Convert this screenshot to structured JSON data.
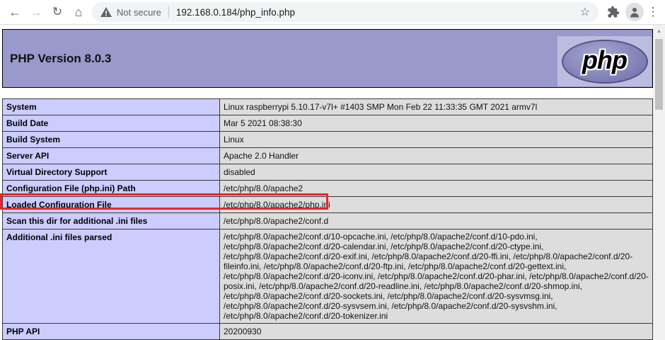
{
  "browser": {
    "back_icon": "←",
    "forward_icon": "→",
    "reload_icon": "↻",
    "home_icon": "⌂",
    "security_label": "Not secure",
    "url": "192.168.0.184/php_info.php",
    "bookmark_icon": "☆",
    "menu_icon": "⋮"
  },
  "phpinfo": {
    "title": "PHP Version 8.0.3",
    "logo_text": "php",
    "rows": [
      {
        "label": "System",
        "value": "Linux raspberrypi 5.10.17-v7l+ #1403 SMP Mon Feb 22 11:33:35 GMT 2021 armv7l"
      },
      {
        "label": "Build Date",
        "value": "Mar 5 2021 08:38:30"
      },
      {
        "label": "Build System",
        "value": "Linux"
      },
      {
        "label": "Server API",
        "value": "Apache 2.0 Handler"
      },
      {
        "label": "Virtual Directory Support",
        "value": "disabled"
      },
      {
        "label": "Configuration File (php.ini) Path",
        "value": "/etc/php/8.0/apache2"
      },
      {
        "label": "Loaded Configuration File",
        "value": "/etc/php/8.0/apache2/php.ini",
        "highlight": true
      },
      {
        "label": "Scan this dir for additional .ini files",
        "value": "/etc/php/8.0/apache2/conf.d"
      },
      {
        "label": "Additional .ini files parsed",
        "value": "/etc/php/8.0/apache2/conf.d/10-opcache.ini, /etc/php/8.0/apache2/conf.d/10-pdo.ini, /etc/php/8.0/apache2/conf.d/20-calendar.ini, /etc/php/8.0/apache2/conf.d/20-ctype.ini, /etc/php/8.0/apache2/conf.d/20-exif.ini, /etc/php/8.0/apache2/conf.d/20-ffi.ini, /etc/php/8.0/apache2/conf.d/20-fileinfo.ini, /etc/php/8.0/apache2/conf.d/20-ftp.ini, /etc/php/8.0/apache2/conf.d/20-gettext.ini, /etc/php/8.0/apache2/conf.d/20-iconv.ini, /etc/php/8.0/apache2/conf.d/20-phar.ini, /etc/php/8.0/apache2/conf.d/20-posix.ini, /etc/php/8.0/apache2/conf.d/20-readline.ini, /etc/php/8.0/apache2/conf.d/20-shmop.ini, /etc/php/8.0/apache2/conf.d/20-sockets.ini, /etc/php/8.0/apache2/conf.d/20-sysvmsg.ini, /etc/php/8.0/apache2/conf.d/20-sysvsem.ini, /etc/php/8.0/apache2/conf.d/20-sysvshm.ini, /etc/php/8.0/apache2/conf.d/20-tokenizer.ini"
      },
      {
        "label": "PHP API",
        "value": "20200930"
      },
      {
        "label": "",
        "value": ""
      }
    ]
  },
  "colors": {
    "header_bg": "#9999cc",
    "label_cell_bg": "#ccccff",
    "value_cell_bg": "#dddddd",
    "highlight_red": "#e8272a",
    "toolbar_icon": "#5f6368",
    "url_text": "#202124",
    "omnibox_bg": "#f1f3f4"
  }
}
